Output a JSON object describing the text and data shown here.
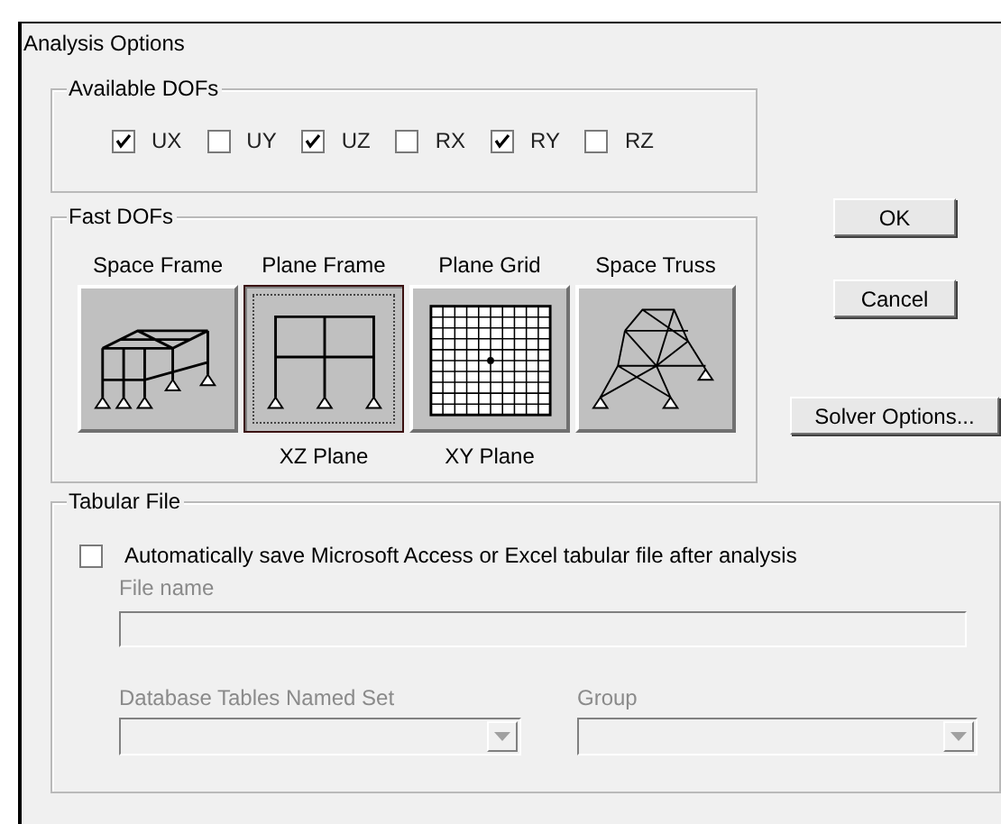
{
  "window": {
    "title": "Analysis Options"
  },
  "available_dofs": {
    "title": "Available DOFs",
    "items": [
      {
        "label": "UX",
        "checked": true
      },
      {
        "label": "UY",
        "checked": false
      },
      {
        "label": "UZ",
        "checked": true
      },
      {
        "label": "RX",
        "checked": false
      },
      {
        "label": "RY",
        "checked": true
      },
      {
        "label": "RZ",
        "checked": false
      }
    ]
  },
  "fast_dofs": {
    "title": "Fast DOFs",
    "items": [
      {
        "label": "Space Frame",
        "kind": "space-frame",
        "selected": false
      },
      {
        "label": "Plane Frame",
        "kind": "plane-frame",
        "selected": true,
        "sublabel": "XZ Plane"
      },
      {
        "label": "Plane Grid",
        "kind": "plane-grid",
        "selected": false,
        "sublabel": "XY Plane"
      },
      {
        "label": "Space Truss",
        "kind": "space-truss",
        "selected": false
      }
    ]
  },
  "buttons": [
    "OK",
    "Cancel",
    "Solver Options..."
  ],
  "tabular_file": {
    "title": "Tabular File",
    "auto_save": {
      "label": "Automatically save Microsoft Access or Excel tabular file after analysis",
      "checked": false
    },
    "file_name": {
      "label": "File name",
      "disabled": true
    },
    "named_set": {
      "label": "Database Tables Named Set",
      "disabled": true
    },
    "group": {
      "label": "Group",
      "disabled": true
    }
  }
}
